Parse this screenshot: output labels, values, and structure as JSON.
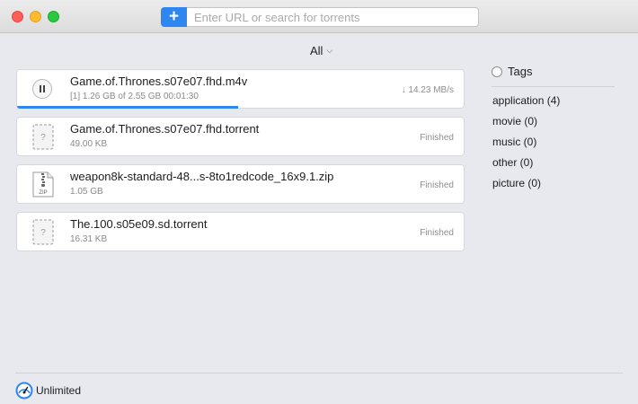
{
  "window": {
    "url_placeholder": "Enter URL or search for torrents",
    "add_label": "+"
  },
  "filter": {
    "label": "All"
  },
  "transfers": [
    {
      "name": "Game.of.Thrones.s07e07.fhd.m4v",
      "meta": "[1]  1.26 GB of 2.55 GB 00:01:30",
      "status": "↓ 14.23 MB/s",
      "progress": 0.494,
      "state": "downloading"
    },
    {
      "name": "Game.of.Thrones.s07e07.fhd.torrent",
      "meta": "49.00 KB",
      "status": "Finished",
      "icon": "unknown-file-icon",
      "icon_label": "?"
    },
    {
      "name": "weapon8k-standard-48...s-8to1redcode_16x9.1.zip",
      "meta": "1.05 GB",
      "status": "Finished",
      "icon": "zip-file-icon",
      "icon_label": "ZIP"
    },
    {
      "name": "The.100.s05e09.sd.torrent",
      "meta": "16.31 KB",
      "status": "Finished",
      "icon": "unknown-file-icon",
      "icon_label": "?"
    }
  ],
  "tags": {
    "title": "Tags",
    "items": [
      "application (4)",
      "movie (0)",
      "music (0)",
      "other (0)",
      "picture (0)"
    ]
  },
  "footer": {
    "speed_label": "Unlimited",
    "icon": "speedometer-icon"
  },
  "colors": {
    "accent": "#2e86f0",
    "background": "#e7e9ee"
  }
}
